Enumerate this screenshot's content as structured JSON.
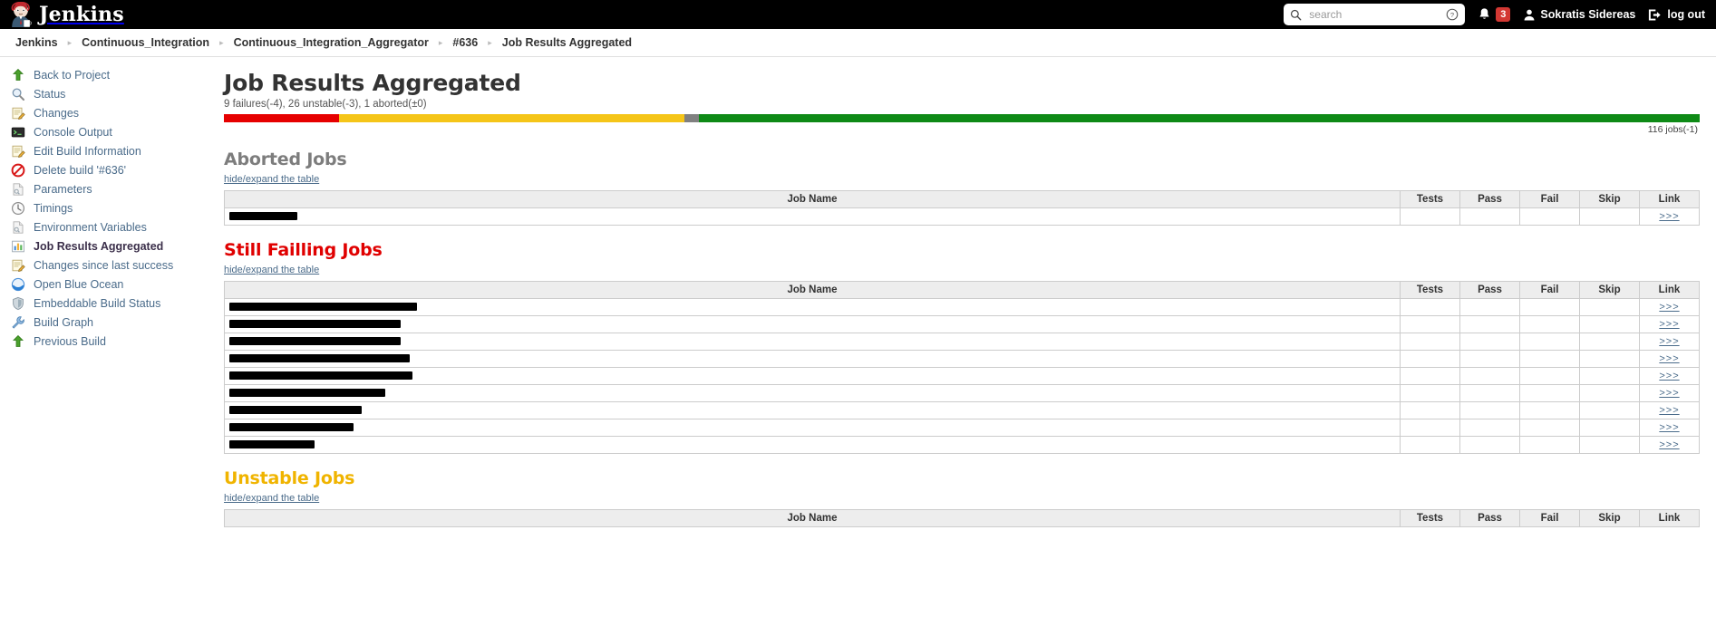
{
  "header": {
    "brand": "Jenkins",
    "logo_icon": "jenkins-butler-icon",
    "search": {
      "placeholder": "search",
      "value": "",
      "icon": "search-icon",
      "help_icon": "help-circle-icon"
    },
    "notifications": {
      "icon": "bell-icon",
      "count": "3"
    },
    "user": {
      "icon": "user-icon",
      "name": "Sokratis Sidereas"
    },
    "logout": {
      "icon": "logout-icon",
      "label": "log out"
    }
  },
  "breadcrumbs": [
    {
      "label": "Jenkins"
    },
    {
      "label": "Continuous_Integration"
    },
    {
      "label": "Continuous_Integration_Aggregator"
    },
    {
      "label": "#636"
    },
    {
      "label": "Job Results Aggregated"
    }
  ],
  "sidebar": {
    "items": [
      {
        "label": "Back to Project",
        "icon": "up-arrow-icon",
        "active": false
      },
      {
        "label": "Status",
        "icon": "magnifier-icon",
        "active": false
      },
      {
        "label": "Changes",
        "icon": "notepad-pencil-icon",
        "active": false
      },
      {
        "label": "Console Output",
        "icon": "terminal-icon",
        "active": false
      },
      {
        "label": "Edit Build Information",
        "icon": "notepad-pencil-icon",
        "active": false
      },
      {
        "label": "Delete build '#636'",
        "icon": "no-entry-icon",
        "active": false
      },
      {
        "label": "Parameters",
        "icon": "document-icon",
        "active": false
      },
      {
        "label": "Timings",
        "icon": "clock-icon",
        "active": false
      },
      {
        "label": "Environment Variables",
        "icon": "document-icon",
        "active": false
      },
      {
        "label": "Job Results Aggregated",
        "icon": "bar-chart-icon",
        "active": true
      },
      {
        "label": "Changes since last success",
        "icon": "notepad-pencil-icon",
        "active": false
      },
      {
        "label": "Open Blue Ocean",
        "icon": "blue-ocean-icon",
        "active": false
      },
      {
        "label": "Embeddable Build Status",
        "icon": "shield-icon",
        "active": false
      },
      {
        "label": "Build Graph",
        "icon": "wrench-icon",
        "active": false
      },
      {
        "label": "Previous Build",
        "icon": "up-arrow-icon",
        "active": false
      }
    ]
  },
  "main": {
    "title": "Job Results Aggregated",
    "summary": "9 failures(-4), 26 unstable(-3), 1 aborted(±0)",
    "jobs_count": "116 jobs(-1)",
    "status_bar": [
      {
        "name": "failures",
        "color": "#e60000",
        "percent": 7.8
      },
      {
        "name": "unstable",
        "color": "#f5c518",
        "percent": 23.4
      },
      {
        "name": "aborted",
        "color": "#808080",
        "percent": 1.0
      },
      {
        "name": "success",
        "color": "#0e8a16",
        "percent": 67.8
      }
    ],
    "table_headers": {
      "job_name": "Job Name",
      "tests": "Tests",
      "pass": "Pass",
      "fail": "Fail",
      "skip": "Skip",
      "link": "Link"
    },
    "link_label": ">>>",
    "hide_expand_label": "hide/expand the table",
    "sections": [
      {
        "key": "aborted",
        "title": "Aborted Jobs",
        "rows": [
          {
            "name_width": 75,
            "tests": "",
            "pass": "",
            "fail": "",
            "skip": ""
          }
        ]
      },
      {
        "key": "failing",
        "title": "Still Failling Jobs",
        "rows": [
          {
            "name_width": 207,
            "tests": "",
            "pass": "",
            "fail": "",
            "skip": ""
          },
          {
            "name_width": 189,
            "tests": "",
            "pass": "",
            "fail": "",
            "skip": ""
          },
          {
            "name_width": 189,
            "tests": "",
            "pass": "",
            "fail": "",
            "skip": ""
          },
          {
            "name_width": 199,
            "tests": "",
            "pass": "",
            "fail": "",
            "skip": ""
          },
          {
            "name_width": 202,
            "tests": "",
            "pass": "",
            "fail": "",
            "skip": ""
          },
          {
            "name_width": 172,
            "tests": "",
            "pass": "",
            "fail": "",
            "skip": ""
          },
          {
            "name_width": 146,
            "tests": "",
            "pass": "",
            "fail": "",
            "skip": ""
          },
          {
            "name_width": 137,
            "tests": "",
            "pass": "",
            "fail": "",
            "skip": ""
          },
          {
            "name_width": 94,
            "tests": "",
            "pass": "",
            "fail": "",
            "skip": ""
          }
        ]
      },
      {
        "key": "unstable",
        "title": "Unstable Jobs",
        "rows": []
      }
    ]
  }
}
